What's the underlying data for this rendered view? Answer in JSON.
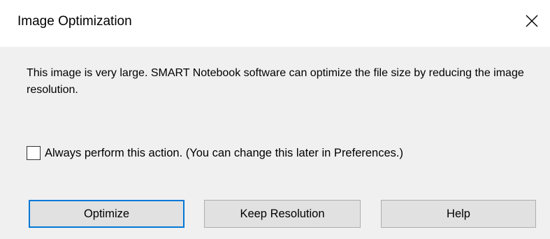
{
  "dialog": {
    "title": "Image Optimization",
    "close_icon": "close-icon",
    "message": "This image is very large. SMART Notebook software can optimize the file size by reducing the image resolution.",
    "checkbox": {
      "label": "Always perform this action. (You can change this later in Preferences.)",
      "checked": false
    },
    "buttons": {
      "optimize": "Optimize",
      "keep_resolution": "Keep Resolution",
      "help": "Help"
    },
    "colors": {
      "titlebar_bg": "#ffffff",
      "body_bg": "#f0f0f0",
      "button_bg": "#e1e1e1",
      "button_border": "#adadad",
      "default_button_border": "#0078d7"
    }
  }
}
